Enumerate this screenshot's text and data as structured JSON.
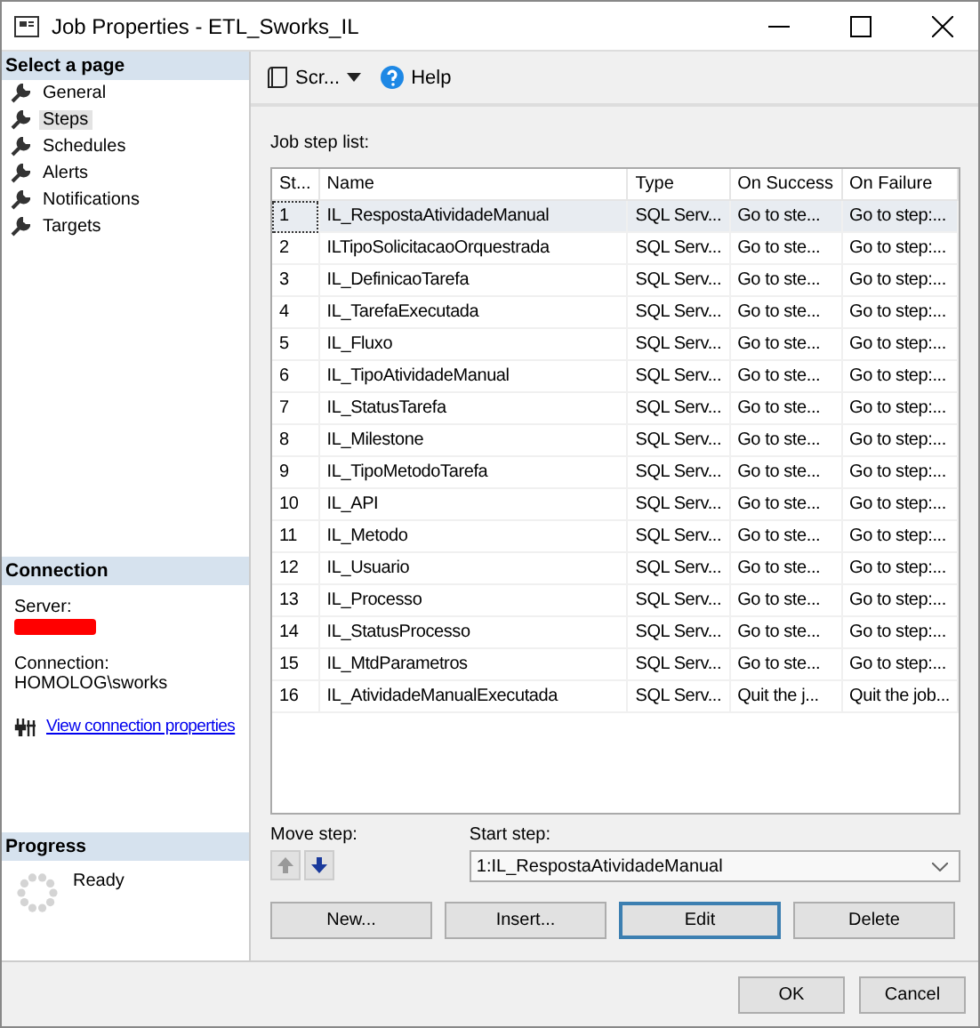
{
  "window": {
    "title": "Job Properties - ETL_Sworks_IL"
  },
  "sidebar": {
    "header": "Select a page",
    "items": [
      {
        "label": "General",
        "selected": false
      },
      {
        "label": "Steps",
        "selected": true
      },
      {
        "label": "Schedules",
        "selected": false
      },
      {
        "label": "Alerts",
        "selected": false
      },
      {
        "label": "Notifications",
        "selected": false
      },
      {
        "label": "Targets",
        "selected": false
      }
    ]
  },
  "connection": {
    "header": "Connection",
    "server_label": "Server:",
    "server_redacted": true,
    "connection_label": "Connection:",
    "connection_value": "HOMOLOG\\sworks",
    "link": "View connection properties"
  },
  "progress": {
    "header": "Progress",
    "status": "Ready"
  },
  "toolbar": {
    "script": "Scr...",
    "help": "Help"
  },
  "steps": {
    "label": "Job step list:",
    "columns": [
      "St...",
      "Name",
      "Type",
      "On Success",
      "On Failure"
    ],
    "rows": [
      {
        "cells": [
          "1",
          "IL_RespostaAtividadeManual",
          "SQL Serv...",
          "Go to ste...",
          "Go to step:..."
        ],
        "selected": true
      },
      {
        "cells": [
          "2",
          "ILTipoSolicitacaoOrquestrada",
          "SQL Serv...",
          "Go to ste...",
          "Go to step:..."
        ],
        "selected": false
      },
      {
        "cells": [
          "3",
          "IL_DefinicaoTarefa",
          "SQL Serv...",
          "Go to ste...",
          "Go to step:..."
        ],
        "selected": false
      },
      {
        "cells": [
          "4",
          "IL_TarefaExecutada",
          "SQL Serv...",
          "Go to ste...",
          "Go to step:..."
        ],
        "selected": false
      },
      {
        "cells": [
          "5",
          "IL_Fluxo",
          "SQL Serv...",
          "Go to ste...",
          "Go to step:..."
        ],
        "selected": false
      },
      {
        "cells": [
          "6",
          "IL_TipoAtividadeManual",
          "SQL Serv...",
          "Go to ste...",
          "Go to step:..."
        ],
        "selected": false
      },
      {
        "cells": [
          "7",
          "IL_StatusTarefa",
          "SQL Serv...",
          "Go to ste...",
          "Go to step:..."
        ],
        "selected": false
      },
      {
        "cells": [
          "8",
          "IL_Milestone",
          "SQL Serv...",
          "Go to ste...",
          "Go to step:..."
        ],
        "selected": false
      },
      {
        "cells": [
          "9",
          "IL_TipoMetodoTarefa",
          "SQL Serv...",
          "Go to ste...",
          "Go to step:..."
        ],
        "selected": false
      },
      {
        "cells": [
          "10",
          "IL_API",
          "SQL Serv...",
          "Go to ste...",
          "Go to step:..."
        ],
        "selected": false
      },
      {
        "cells": [
          "11",
          "IL_Metodo",
          "SQL Serv...",
          "Go to ste...",
          "Go to step:..."
        ],
        "selected": false
      },
      {
        "cells": [
          "12",
          "IL_Usuario",
          "SQL Serv...",
          "Go to ste...",
          "Go to step:..."
        ],
        "selected": false
      },
      {
        "cells": [
          "13",
          "IL_Processo",
          "SQL Serv...",
          "Go to ste...",
          "Go to step:..."
        ],
        "selected": false
      },
      {
        "cells": [
          "14",
          "IL_StatusProcesso",
          "SQL Serv...",
          "Go to ste...",
          "Go to step:..."
        ],
        "selected": false
      },
      {
        "cells": [
          "15",
          "IL_MtdParametros",
          "SQL Serv...",
          "Go to ste...",
          "Go to step:..."
        ],
        "selected": false
      },
      {
        "cells": [
          "16",
          "IL_AtividadeManualExecutada",
          "SQL Serv...",
          "Quit the j...",
          "Quit the job..."
        ],
        "selected": false
      }
    ]
  },
  "move_step": {
    "label": "Move step:",
    "up_disabled": true,
    "down_disabled": false
  },
  "start_step": {
    "label": "Start step:",
    "value": "1:IL_RespostaAtividadeManual"
  },
  "step_buttons": [
    {
      "label": "New...",
      "default": false
    },
    {
      "label": "Insert...",
      "default": false
    },
    {
      "label": "Edit",
      "default": true
    },
    {
      "label": "Delete",
      "default": false
    }
  ],
  "dialog_buttons": [
    "OK",
    "Cancel"
  ]
}
